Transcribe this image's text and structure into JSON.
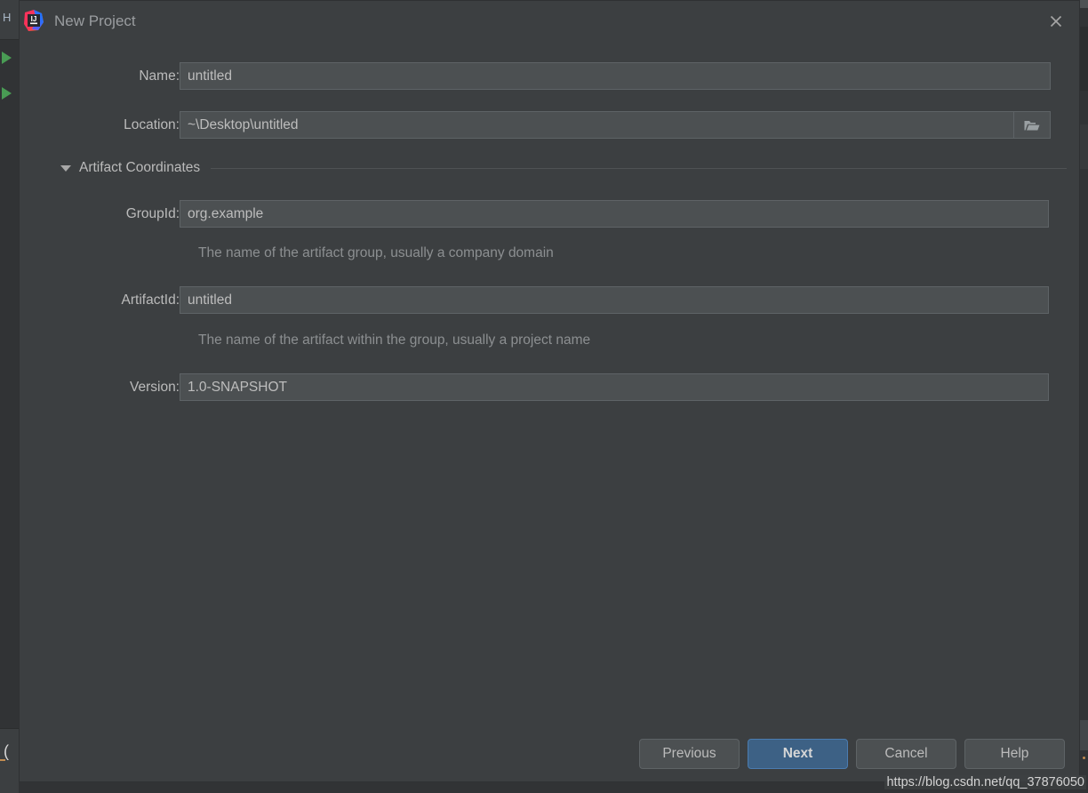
{
  "window": {
    "title": "New Project",
    "logo_icon": "intellij-idea-logo",
    "close_icon": "close-icon"
  },
  "form": {
    "name": {
      "label": "Name:",
      "value": "untitled",
      "placeholder": "untitled"
    },
    "location": {
      "label": "Location:",
      "value": "~\\Desktop\\untitled",
      "placeholder": "~\\Desktop\\untitled",
      "browse_icon": "folder-icon"
    },
    "artifact_section": {
      "title": "Artifact Coordinates",
      "expanded": true,
      "caret_icon": "chevron-down-icon",
      "group_id": {
        "label": "GroupId:",
        "value": "org.example",
        "placeholder": "org.example",
        "hint": "The name of the artifact group, usually a company domain"
      },
      "artifact_id": {
        "label": "ArtifactId:",
        "value": "untitled",
        "placeholder": "untitled",
        "hint": "The name of the artifact within the group, usually a project name"
      },
      "version": {
        "label": "Version:",
        "value": "1.0-SNAPSHOT",
        "placeholder": "1.0-SNAPSHOT"
      }
    }
  },
  "buttons": {
    "previous": "Previous",
    "next": "Next",
    "cancel": "Cancel",
    "help": "Help"
  },
  "backdrop": {
    "tab_letter": "H",
    "paren_glyph": "("
  },
  "watermark": {
    "text": "https://blog.csdn.net/qq_37876050"
  },
  "colors": {
    "dialog_background": "#3c3f41",
    "input_background": "#4c5052",
    "input_border": "#5e6366",
    "label_text": "#bbbbbb",
    "hint_text": "#8c8f91",
    "title_text": "#9a9da0",
    "primary_button": "#3d6185",
    "primary_button_border": "#4a7cb0",
    "run_arrow_green": "#499c54"
  }
}
